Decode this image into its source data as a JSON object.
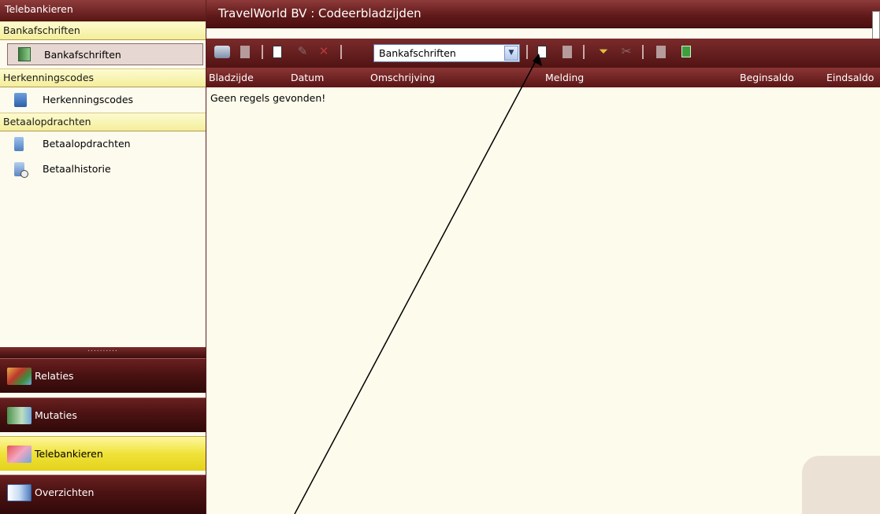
{
  "sidebar": {
    "title": "Telebankieren",
    "sections": [
      {
        "label": "Bankafschriften",
        "items": [
          {
            "label": "Bankafschriften",
            "icon": "statement-icon"
          }
        ]
      },
      {
        "label": "Herkenningscodes",
        "items": [
          {
            "label": "Herkenningscodes",
            "icon": "code-edit-icon"
          }
        ]
      },
      {
        "label": "Betaalopdrachten",
        "items": [
          {
            "label": "Betaalopdrachten",
            "icon": "document-icon"
          },
          {
            "label": "Betaalhistorie",
            "icon": "history-icon"
          }
        ]
      }
    ],
    "splitter": "..........",
    "nav": [
      {
        "label": "Relaties",
        "icon": "relations-icon"
      },
      {
        "label": "Mutaties",
        "icon": "mutations-icon"
      },
      {
        "label": "Telebankieren",
        "icon": "telebanking-icon",
        "active": true
      },
      {
        "label": "Overzichten",
        "icon": "reports-icon"
      }
    ]
  },
  "main": {
    "title": "TravelWorld BV : Codeerbladzijden",
    "combo": {
      "value": "Bankafschriften"
    },
    "columns": [
      "Bladzijde",
      "Datum",
      "Omschrijving",
      "Melding",
      "Beginsaldo",
      "Eindsaldo"
    ],
    "empty_message": "Geen regels gevonden!"
  },
  "colors": {
    "header_dark_red": "#5b1717",
    "section_yellow": "#f4ee9a",
    "active_nav_yellow": "#f0e23a",
    "panel_background": "#fdfbee"
  }
}
